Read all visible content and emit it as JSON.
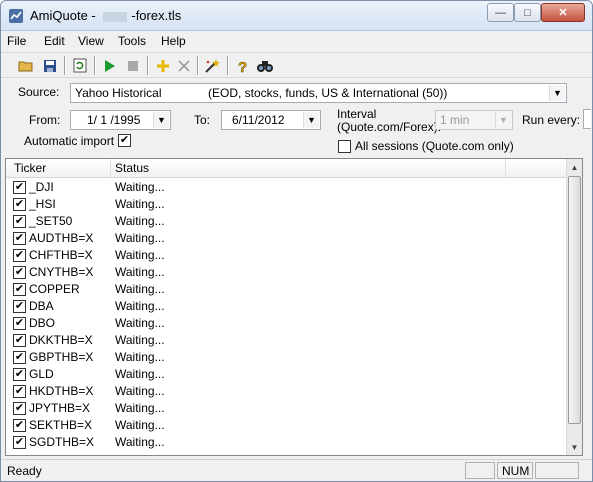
{
  "window": {
    "title_prefix": "AmiQuote - ",
    "title_suffix": "-forex.tls",
    "minimize_glyph": "—",
    "maximize_glyph": "□",
    "close_glyph": "✕"
  },
  "menu": [
    "File",
    "Edit",
    "View",
    "Tools",
    "Help"
  ],
  "toolbar": {
    "icons": [
      "open-folder-icon",
      "save-icon",
      "refresh-icon",
      "play-icon",
      "stop-icon",
      "add-icon",
      "delete-icon",
      "wand-icon",
      "help-icon",
      "find-icon"
    ]
  },
  "source": {
    "label": "Source:",
    "value": "Yahoo Historical",
    "description": "(EOD, stocks, funds, US & International (50))"
  },
  "from": {
    "label": "From:",
    "value": "1/ 1 /1995"
  },
  "to": {
    "label": "To:",
    "value": "6/11/2012"
  },
  "interval": {
    "label_line1": "Interval",
    "label_line2": "(Quote.com/Forex):",
    "value": "1 min"
  },
  "run_every": {
    "label": "Run every:"
  },
  "automatic_import": {
    "label": "Automatic import",
    "checked": true
  },
  "all_sessions": {
    "label": "All sessions (Quote.com only)",
    "checked": false
  },
  "list": {
    "columns": [
      "Ticker",
      "Status"
    ],
    "rows": [
      {
        "ticker": "_DJI",
        "status": "Waiting...",
        "checked": true
      },
      {
        "ticker": "_HSI",
        "status": "Waiting...",
        "checked": true
      },
      {
        "ticker": "_SET50",
        "status": "Waiting...",
        "checked": true
      },
      {
        "ticker": "AUDTHB=X",
        "status": "Waiting...",
        "checked": true
      },
      {
        "ticker": "CHFTHB=X",
        "status": "Waiting...",
        "checked": true
      },
      {
        "ticker": "CNYTHB=X",
        "status": "Waiting...",
        "checked": true
      },
      {
        "ticker": "COPPER",
        "status": "Waiting...",
        "checked": true
      },
      {
        "ticker": "DBA",
        "status": "Waiting...",
        "checked": true
      },
      {
        "ticker": "DBO",
        "status": "Waiting...",
        "checked": true
      },
      {
        "ticker": "DKKTHB=X",
        "status": "Waiting...",
        "checked": true
      },
      {
        "ticker": "GBPTHB=X",
        "status": "Waiting...",
        "checked": true
      },
      {
        "ticker": "GLD",
        "status": "Waiting...",
        "checked": true
      },
      {
        "ticker": "HKDTHB=X",
        "status": "Waiting...",
        "checked": true
      },
      {
        "ticker": "JPYTHB=X",
        "status": "Waiting...",
        "checked": true
      },
      {
        "ticker": "SEKTHB=X",
        "status": "Waiting...",
        "checked": true
      },
      {
        "ticker": "SGDTHB=X",
        "status": "Waiting...",
        "checked": true
      }
    ]
  },
  "statusbar": {
    "text": "Ready",
    "num": "NUM"
  }
}
